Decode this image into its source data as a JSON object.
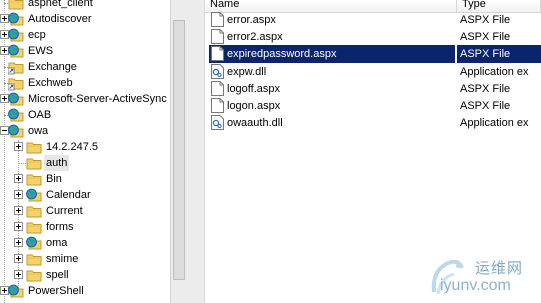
{
  "tree": {
    "items": [
      {
        "label": "aspnet_client",
        "icon": "folder-icon"
      },
      {
        "label": "Autodiscover",
        "icon": "web-app-icon"
      },
      {
        "label": "ecp",
        "icon": "web-app-icon"
      },
      {
        "label": "EWS",
        "icon": "web-app-icon"
      },
      {
        "label": "Exchange",
        "icon": "folder-shortcut-icon"
      },
      {
        "label": "Exchweb",
        "icon": "folder-shortcut-icon"
      },
      {
        "label": "Microsoft-Server-ActiveSync",
        "icon": "web-app-icon"
      },
      {
        "label": "OAB",
        "icon": "web-app-icon"
      },
      {
        "label": "owa",
        "icon": "web-app-icon"
      },
      {
        "label": "14.2.247.5",
        "icon": "folder-icon"
      },
      {
        "label": "auth",
        "icon": "folder-icon"
      },
      {
        "label": "Bin",
        "icon": "folder-icon"
      },
      {
        "label": "Calendar",
        "icon": "web-app-icon"
      },
      {
        "label": "Current",
        "icon": "folder-icon"
      },
      {
        "label": "forms",
        "icon": "folder-icon"
      },
      {
        "label": "oma",
        "icon": "web-app-icon"
      },
      {
        "label": "smime",
        "icon": "folder-icon"
      },
      {
        "label": "spell",
        "icon": "folder-icon"
      },
      {
        "label": "PowerShell",
        "icon": "web-app-icon"
      }
    ]
  },
  "list": {
    "columns": {
      "name": "Name",
      "type": "Type"
    },
    "rows": [
      {
        "name": "error.aspx",
        "type": "ASPX File",
        "icon": "document-icon"
      },
      {
        "name": "error2.aspx",
        "type": "ASPX File",
        "icon": "document-icon"
      },
      {
        "name": "expiredpassword.aspx",
        "type": "ASPX File",
        "icon": "document-icon",
        "selected": true
      },
      {
        "name": "expw.dll",
        "type": "Application ex",
        "icon": "dll-icon"
      },
      {
        "name": "logoff.aspx",
        "type": "ASPX File",
        "icon": "document-icon"
      },
      {
        "name": "logon.aspx",
        "type": "ASPX File",
        "icon": "document-icon"
      },
      {
        "name": "owaauth.dll",
        "type": "Application ex",
        "icon": "dll-icon"
      }
    ]
  },
  "watermark": {
    "title": "运维网",
    "url": "iyunv.com"
  },
  "colors": {
    "selection": "#0a2470",
    "folder": "#f2d36b",
    "globe": "#2d8fd6"
  }
}
